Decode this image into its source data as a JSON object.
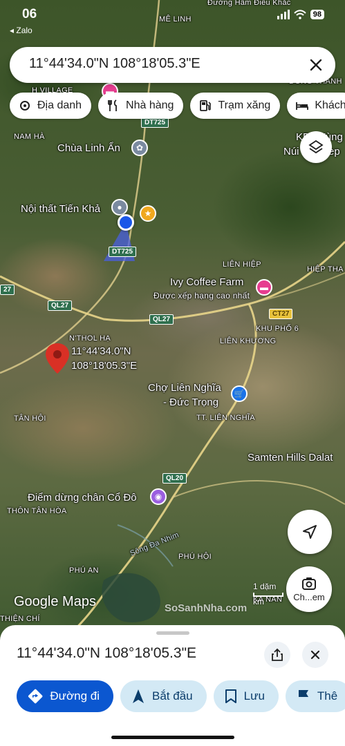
{
  "status_bar": {
    "time": "06",
    "back_label": "◂ Zalo",
    "battery": "98"
  },
  "search": {
    "query": "11°44'34.0\"N 108°18'05.3\"E"
  },
  "chips": [
    {
      "label": "Địa danh",
      "icon": "landmark-icon"
    },
    {
      "label": "Nhà hàng",
      "icon": "restaurant-icon"
    },
    {
      "label": "Trạm xăng",
      "icon": "gas-station-icon"
    },
    {
      "label": "Khách",
      "icon": "hotel-icon"
    }
  ],
  "map": {
    "place_labels": {
      "me_linh": "MÊ LINH",
      "nam_ha": "NAM HÀ",
      "lien_hiep": "LIÊN HIỆP",
      "hiep_thanh": "HIỆP THẠ",
      "n_thol_ha": "N'THOL HẠ",
      "lien_khuong": "LIÊN KHƯƠNG",
      "khu_pho_6": "KHU PHỐ 6",
      "tan_hoi": "TÂN HỘI",
      "tt_lien_nghia": "TT. LIÊN NGHĨA",
      "thon_tan_hoa": "THÔN TÂN HÒA",
      "phu_hoi": "PHÚ HỘI",
      "phu_an": "PHÚ AN",
      "ka_nan": "KA NAN",
      "thien_chi": "THIỆN CHÍ",
      "h_village": "H VILLAGE",
      "dong_thanh": "ĐÔNG THANH",
      "river": "Sông Đa Nhim",
      "top_cut": "Đường Hầm Điêu Khắc",
      "ky_vung": "KDL Vùng",
      "nui_voi": "Núi Voi Elep"
    },
    "poi": {
      "chua_linh_an": "Chùa Linh Ẩn",
      "noi_that": "Nội thất Tiến Khả",
      "ivy_coffee": "Ivy Coffee Farm",
      "ivy_sub": "Được xếp hạng cao nhất",
      "cho_lien_nghia_1": "Chợ Liên Nghĩa",
      "cho_lien_nghia_2": "- Đức Trọng",
      "samten": "Samten Hills Dalat",
      "diem_dung": "Điểm dừng chân Cổ Đô"
    },
    "pin_label_1": "11°44'34.0\"N",
    "pin_label_2": "108°18'05.3\"E",
    "roads": {
      "dt725_a": "DT725",
      "dt725_b": "DT725",
      "ql27_a": "QL27",
      "ql27_b": "QL27",
      "ct27": "CT27",
      "ql20": "QL20",
      "edge_27": "27"
    },
    "google_maps": "Google Maps",
    "scale_text": "1 dặm",
    "scale_km": "km",
    "lens_label": "Ch...em",
    "watermark": "SoSanhNha.com"
  },
  "sheet": {
    "title": "11°44'34.0\"N 108°18'05.3\"E",
    "actions": [
      {
        "label": "Đường đi"
      },
      {
        "label": "Bắt đầu"
      },
      {
        "label": "Lưu"
      },
      {
        "label": "Thê"
      }
    ]
  },
  "colors": {
    "primary": "#0b57d0",
    "tonal": "#d3e9f5",
    "pin_red": "#d93025"
  }
}
